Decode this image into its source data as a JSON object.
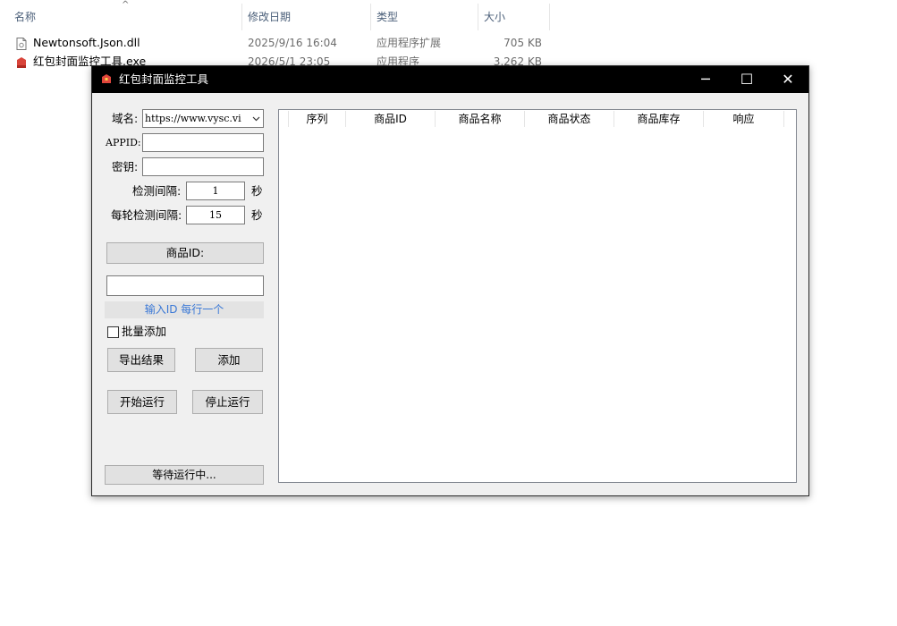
{
  "explorer": {
    "columns": {
      "name": "名称",
      "date": "修改日期",
      "type": "类型",
      "size": "大小"
    },
    "files": [
      {
        "name": "Newtonsoft.Json.dll",
        "date": "2025/9/16 16:04",
        "type": "应用程序扩展",
        "size": "705 KB"
      },
      {
        "name": "红包封面监控工具.exe",
        "date": "2026/5/1 23:05",
        "type": "应用程序",
        "size": "3,262 KB"
      }
    ]
  },
  "window": {
    "title": "红包封面监控工具",
    "controls": {
      "minimize": "─",
      "maximize": "☐",
      "close": "✕"
    }
  },
  "form": {
    "domain_label": "域名:",
    "domain_value": "https://www.vysc.vi",
    "appid_label": "APPID:",
    "appid_value": "",
    "secret_label": "密钥:",
    "secret_value": "",
    "interval_label": "检测间隔:",
    "interval_value": "1",
    "interval_unit": "秒",
    "round_interval_label": "每轮检测间隔:",
    "round_interval_value": "15",
    "round_interval_unit": "秒",
    "product_id_button": "商品ID:",
    "product_id_value": "",
    "hint": "输入ID 每行一个",
    "batch_add_label": "批量添加",
    "export_button": "导出结果",
    "add_button": "添加",
    "start_button": "开始运行",
    "stop_button": "停止运行",
    "status_button": "等待运行中..."
  },
  "table": {
    "columns": [
      "序列",
      "商品ID",
      "商品名称",
      "商品状态",
      "商品库存",
      "响应"
    ]
  }
}
